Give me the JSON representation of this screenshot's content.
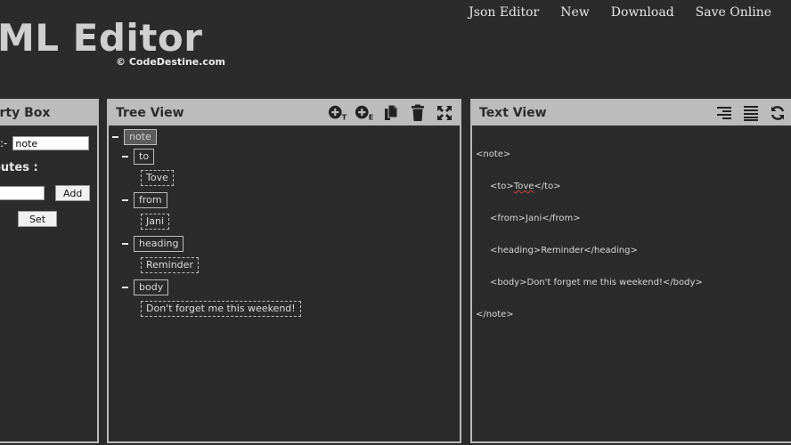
{
  "nav": {
    "items": [
      "Json Editor",
      "New",
      "Download",
      "Save Online"
    ]
  },
  "header": {
    "title": "ML Editor",
    "copyright": "© CodeDestine.com"
  },
  "property_box": {
    "title": "perty Box",
    "name_label": ":-",
    "name_value": "note",
    "attributes_label": "outes :",
    "attr_input_value": "",
    "add_label": "Add",
    "set_label": "Set"
  },
  "tree_view": {
    "title": "Tree View",
    "tools": [
      "add-text-icon",
      "add-element-icon",
      "copy-icon",
      "delete-icon",
      "expand-icon"
    ],
    "root": "note",
    "children": [
      {
        "tag": "to",
        "text": "Tove"
      },
      {
        "tag": "from",
        "text": "Jani"
      },
      {
        "tag": "heading",
        "text": "Reminder"
      },
      {
        "tag": "body",
        "text": "Don't forget me this weekend!"
      }
    ]
  },
  "text_view": {
    "title": "Text View",
    "tools": [
      "align-right-icon",
      "align-justify-icon",
      "refresh-icon"
    ],
    "lines": {
      "open_note": "<note>",
      "to_open": "<to>",
      "to_text": "Tove",
      "to_close": "</to>",
      "from": "<from>Jani</from>",
      "heading": "<heading>Reminder</heading>",
      "body": "<body>Don't forget me this weekend!</body>",
      "close_note": "</note>"
    }
  },
  "colors": {
    "background": "#2b2b2b",
    "panel_header": "#bcbcbc",
    "panel_border": "#b9b9b9"
  }
}
